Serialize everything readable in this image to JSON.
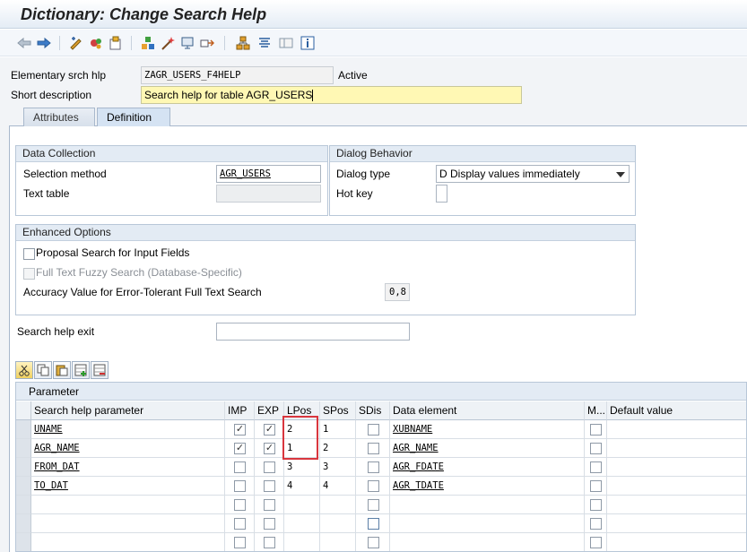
{
  "window": {
    "title": "Dictionary: Change Search Help"
  },
  "toolbar": {
    "icons": [
      "back-arrow-icon",
      "forward-arrow-icon",
      "display-change-icon",
      "activate-icon",
      "other-object-icon",
      "check-icon",
      "activate-wand-icon",
      "test-icon",
      "where-used-icon",
      "hierarchy-icon",
      "object-list-icon",
      "display-object-list-icon",
      "info-icon"
    ]
  },
  "header": {
    "name_label": "Elementary srch hlp",
    "name_value": "ZAGR_USERS_F4HELP",
    "status": "Active",
    "desc_label": "Short description",
    "desc_value": "Search help for table AGR_USERS"
  },
  "tabs": [
    {
      "label": "Attributes",
      "active": false
    },
    {
      "label": "Definition",
      "active": true
    }
  ],
  "data_collection": {
    "title": "Data Collection",
    "selection_method_label": "Selection method",
    "selection_method_value": "AGR_USERS",
    "text_table_label": "Text table",
    "text_table_value": ""
  },
  "dialog_behavior": {
    "title": "Dialog Behavior",
    "dialog_type_label": "Dialog type",
    "dialog_type_value": "D Display values immediately",
    "hot_key_label": "Hot key",
    "hot_key_value": ""
  },
  "enhanced_options": {
    "title": "Enhanced Options",
    "proposal_label": "Proposal Search for Input Fields",
    "proposal_checked": false,
    "fuzzy_label": "Full Text Fuzzy Search (Database-Specific)",
    "fuzzy_checked": false,
    "accuracy_label": "Accuracy Value for Error-Tolerant Full Text Search",
    "accuracy_value": "0,8"
  },
  "search_help_exit": {
    "label": "Search help exit",
    "value": ""
  },
  "parameter_table": {
    "title": "Parameter",
    "toolbar_icons": [
      "cut-icon",
      "copy-icon",
      "paste-icon",
      "insert-row-icon",
      "delete-row-icon"
    ],
    "columns": [
      "Search help parameter",
      "IMP",
      "EXP",
      "LPos",
      "SPos",
      "SDis",
      "Data element",
      "M...",
      "Default value"
    ],
    "rows": [
      {
        "param": "UNAME",
        "imp": true,
        "exp": true,
        "lpos": "2",
        "spos": "1",
        "sdis": false,
        "data_element": "XUBNAME",
        "mod": false,
        "default": ""
      },
      {
        "param": "AGR_NAME",
        "imp": true,
        "exp": true,
        "lpos": "1",
        "spos": "2",
        "sdis": false,
        "data_element": "AGR_NAME",
        "mod": false,
        "default": ""
      },
      {
        "param": "FROM_DAT",
        "imp": false,
        "exp": false,
        "lpos": "3",
        "spos": "3",
        "sdis": false,
        "data_element": "AGR_FDATE",
        "mod": false,
        "default": ""
      },
      {
        "param": "TO_DAT",
        "imp": false,
        "exp": false,
        "lpos": "4",
        "spos": "4",
        "sdis": false,
        "data_element": "AGR_TDATE",
        "mod": false,
        "default": ""
      },
      {
        "param": "",
        "imp": false,
        "exp": false,
        "lpos": "",
        "spos": "",
        "sdis": false,
        "data_element": "",
        "mod": false,
        "default": ""
      },
      {
        "param": "",
        "imp": false,
        "exp": false,
        "lpos": "",
        "spos": "",
        "sdis": false,
        "data_element": "",
        "mod": false,
        "default": ""
      },
      {
        "param": "",
        "imp": false,
        "exp": false,
        "lpos": "",
        "spos": "",
        "sdis": false,
        "data_element": "",
        "mod": false,
        "default": ""
      }
    ]
  },
  "colors": {
    "highlight_box": "#d9363e",
    "yellow_field": "#fff8b4",
    "group_header": "#e3ebf4"
  }
}
